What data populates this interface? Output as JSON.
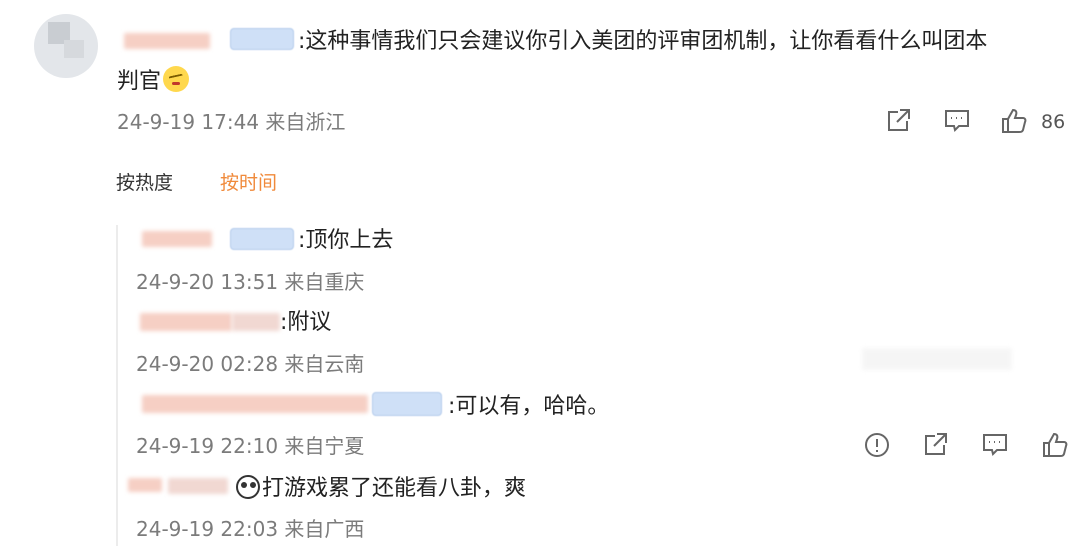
{
  "top_comment": {
    "text_line1": ":这种事情我们只会建议你引入美团的评审团机制，让你看看什么叫团本",
    "text_line2": "判官",
    "meta": "24-9-19 17:44 来自浙江",
    "like_count": "86",
    "icons": [
      "share-icon",
      "comment-icon",
      "like-icon"
    ]
  },
  "sort": {
    "hot_label": "按热度",
    "time_label": "按时间",
    "active_color": "#f08a3b"
  },
  "replies": [
    {
      "text": ":顶你上去",
      "meta": "24-9-20 13:51 来自重庆"
    },
    {
      "text": ":附议",
      "meta": "24-9-20 02:28 来自云南"
    },
    {
      "text": ":可以有，哈哈。",
      "meta": "24-9-19 22:10 来自宁夏",
      "icons": [
        "report-icon",
        "share-icon",
        "comment-icon",
        "like-icon"
      ]
    },
    {
      "text": "打游戏累了还能看八卦，爽",
      "meta": "24-9-19 22:03 来自广西"
    }
  ]
}
